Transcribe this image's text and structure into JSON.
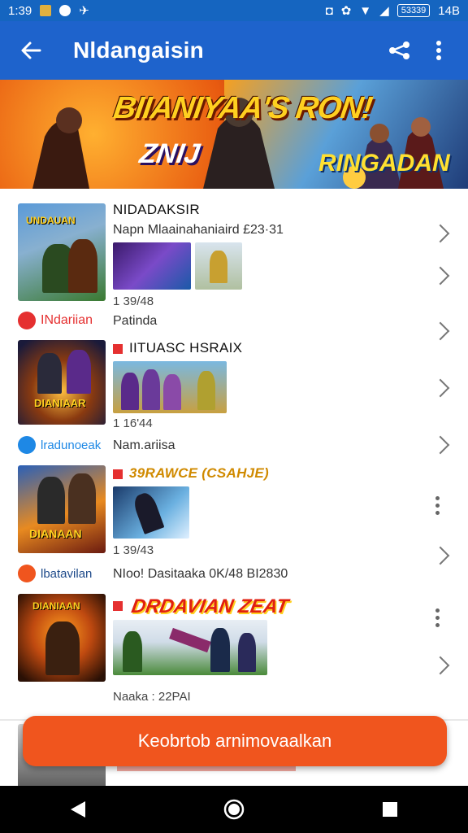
{
  "status": {
    "time": "1:39",
    "battery": "53339",
    "clock_right": "14B"
  },
  "appbar": {
    "title": "Nldangaisin"
  },
  "banner": {
    "title1": "BIIANIYAA'S RON!",
    "title2": "ZNIJ",
    "title3": "RINGADAN"
  },
  "items": [
    {
      "title": "NIDADAKSIR",
      "subtitle": "Napn Mlaainahaniaird £23·31",
      "meta": "1 39/48",
      "source": {
        "label": "INdariian",
        "color": "#e53030"
      },
      "source_desc": "Patinda"
    },
    {
      "title": "IITUASC HSRAIX",
      "subtitle": "",
      "meta": "1 16'44",
      "source": {
        "label": "lradunoeak",
        "color": "#1e88e5"
      },
      "source_desc": "Nam.ariisa"
    },
    {
      "title": "39RAWCE (CSAHJE)",
      "subtitle": "",
      "meta": "1 39/43",
      "source": {
        "label": "lbatavilan",
        "color": "#f0551e"
      },
      "source_desc": "NIoo! Dasitaaka 0K/48 BI2830"
    },
    {
      "title": "",
      "subtitle": "",
      "meta": "Naaka : 22PAI"
    }
  ],
  "fab": {
    "label": "Keobrtob arnimovaalkan"
  },
  "colors": {
    "appbar": "#1e63cc",
    "statusbar": "#1565c0",
    "accent": "#f0551e"
  }
}
